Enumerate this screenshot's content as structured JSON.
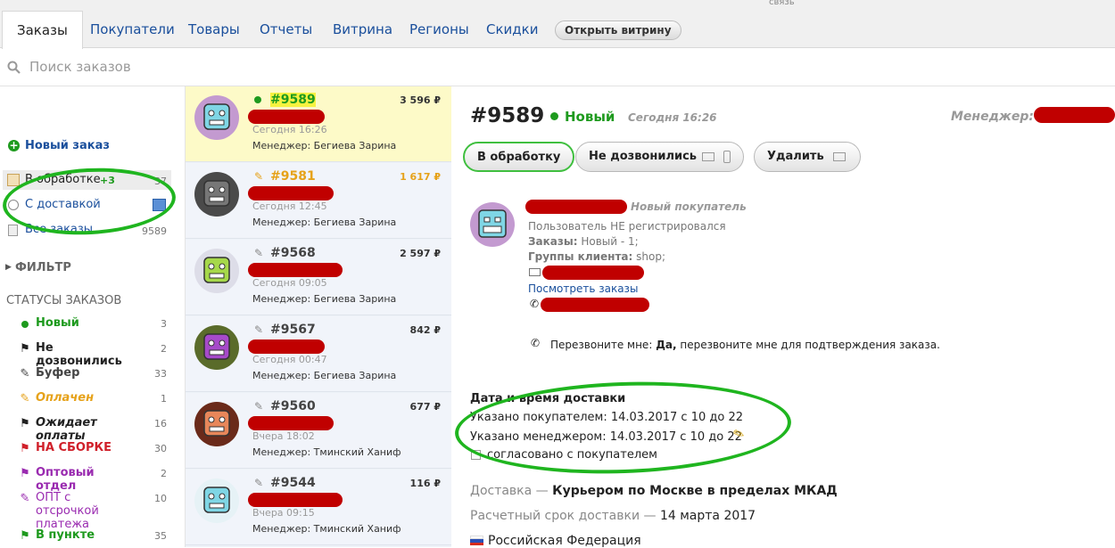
{
  "tabs": [
    "Заказы",
    "Покупатели",
    "Товары",
    "Отчеты",
    "Витрина",
    "Регионы",
    "Скидки"
  ],
  "open_shop": "Открыть витрину",
  "top_right_text": "связь",
  "search": {
    "placeholder": "Поиск заказов"
  },
  "sidebar": {
    "new_order": "Новый заказ",
    "in_work": {
      "label": "В обработке",
      "badge": "+3",
      "count": "37"
    },
    "delivery": {
      "label": "С доставкой"
    },
    "all_orders": {
      "label": "Все заказы",
      "count": "9589"
    },
    "filter": "ФИЛЬТР",
    "statuses_title": "СТАТУСЫ ЗАКАЗОВ",
    "statuses": [
      {
        "label": "Новый",
        "count": "3",
        "color": "#1e9a1e",
        "icon": "green-dot-icon"
      },
      {
        "label": "Не дозвонились",
        "count": "2",
        "color": "#222222",
        "icon": "black-flag-icon"
      },
      {
        "label": "Буфер",
        "count": "33",
        "color": "#444444",
        "icon": "pencil-icon"
      },
      {
        "label": "Оплачен",
        "count": "1",
        "color": "#e6a21a",
        "icon": "yellow-pencil-icon"
      },
      {
        "label": "Ожидает оплаты",
        "count": "16",
        "color": "#222222",
        "icon": "black-flag-icon"
      },
      {
        "label": "НА СБОРКЕ",
        "count": "30",
        "color": "#d0202a",
        "icon": "red-flag-icon"
      },
      {
        "label": "Оптовый отдел",
        "count": "2",
        "color": "#9a2bb0",
        "icon": "purple-flag-icon"
      },
      {
        "label": "ОПТ с отсрочкой платежа",
        "count": "10",
        "color": "#9a2bb0",
        "icon": "purple-pencil-icon"
      },
      {
        "label": "В пункте",
        "count": "35",
        "color": "#1e9a1e",
        "icon": "green-flag-icon"
      }
    ]
  },
  "orders": [
    {
      "number": "#9589",
      "price": "3 596 ₽",
      "time": "Сегодня 16:26",
      "manager": "Менеджер: Бегиева Зарина",
      "color": "#1e9a1e"
    },
    {
      "number": "#9581",
      "price": "1 617 ₽",
      "time": "Сегодня 12:45",
      "manager": "Менеджер: Бегиева Зарина",
      "color": "#e6a21a"
    },
    {
      "number": "#9568",
      "price": "2 597 ₽",
      "time": "Сегодня 09:05",
      "manager": "Менеджер: Бегиева Зарина",
      "color": "#444444"
    },
    {
      "number": "#9567",
      "price": "842 ₽",
      "time": "Сегодня 00:47",
      "manager": "Менеджер: Бегиева Зарина",
      "color": "#444444"
    },
    {
      "number": "#9560",
      "price": "677 ₽",
      "time": "Вчера 18:02",
      "manager": "Менеджер: Тминский Ханиф",
      "color": "#444444"
    },
    {
      "number": "#9544",
      "price": "116 ₽",
      "time": "Вчера 09:15",
      "manager": "Менеджер: Тминский Ханиф",
      "color": "#444444"
    }
  ],
  "detail": {
    "number": "#9589",
    "status": "Новый",
    "time": "Сегодня 16:26",
    "manager_label": "Менеджер:",
    "buttons": {
      "process": "В обработку",
      "no_answer": "Не дозвонились",
      "delete": "Удалить"
    },
    "customer": {
      "tag": "Новый покупатель",
      "not_registered": "Пользователь НЕ регистрировался",
      "orders_label": "Заказы:",
      "orders_value": "Новый - 1;",
      "groups_label": "Группы клиента:",
      "groups_value": "shop;",
      "view_orders": "Посмотреть заказы"
    },
    "callback": {
      "label": "Перезвоните мне:",
      "value": "Да,",
      "text": "перезвоните мне для подтверждения заказа."
    },
    "delivery_time": {
      "title": "Дата и время доставки",
      "by_customer": "Указано покупателем: 14.03.2017 с 10 до 22",
      "by_manager": "Указано менеджером: 14.03.2017 с 10 до 22",
      "agreed": "согласовано с покупателем"
    },
    "delivery": {
      "label": "Доставка —",
      "value": "Курьером по Москве в пределах МКАД"
    },
    "eta": {
      "label": "Расчетный срок доставки —",
      "value": "14 марта 2017"
    },
    "country": "Российская Федерация"
  }
}
